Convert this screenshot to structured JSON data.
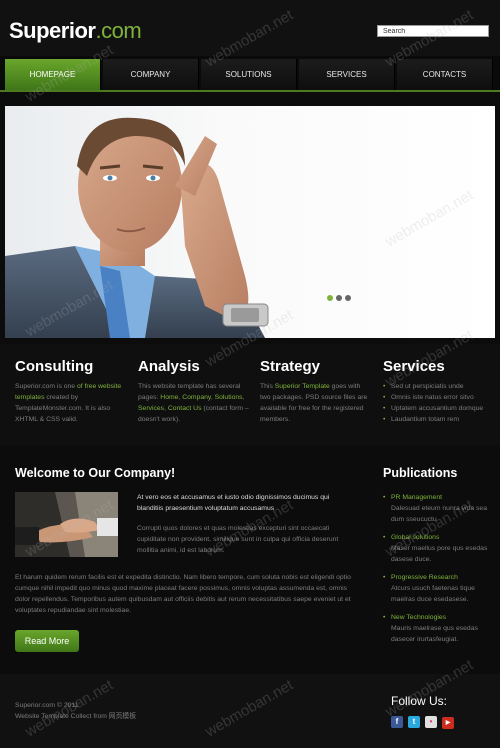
{
  "header": {
    "logo_part1": "Superior",
    "logo_part2": ".com",
    "search_value": "Search"
  },
  "nav": {
    "items": [
      {
        "label": "HOMEPAGE",
        "active": true
      },
      {
        "label": "COMPANY",
        "active": false
      },
      {
        "label": "SOLUTIONS",
        "active": false
      },
      {
        "label": "SERVICES",
        "active": false
      },
      {
        "label": "CONTACTS",
        "active": false
      }
    ]
  },
  "hero": {
    "slides": 3,
    "active_slide": 1
  },
  "columns": {
    "consulting": {
      "title": "Consulting",
      "t1": "Superior.com is one ",
      "link1": "of free website templates",
      "t2": " created by TemplateMonster.com. It is also XHTML & CSS valid."
    },
    "analysis": {
      "title": "Analysis",
      "t1": "This website template has several pages: ",
      "link1": "Home",
      "sep1": ", ",
      "link2": "Company",
      "sep2": ", ",
      "link3": "Solutions",
      "sep3": ", ",
      "link4": "Services",
      "sep4": ", ",
      "link5": "Contact Us",
      "t2": " (contact form – doesn't work)."
    },
    "strategy": {
      "title": "Strategy",
      "t1": "This ",
      "link1": "Superior Template",
      "t2": " goes with two packages. PSD source files are available for free for the registered members."
    },
    "services": {
      "title": "Services",
      "items": [
        "Sed ut perspiciatis unde",
        "Omnis iste natus error sitvo",
        "Uptatem accusantium domque",
        "Laudantium totam rem"
      ]
    }
  },
  "welcome": {
    "title": "Welcome to Our Company!",
    "lead": "At vero eos et accusamus et iusto odio dignissimos ducimus qui blanditiis praesentium voluptatum accusamus",
    "lead2": "Corrupti quos dolores et quas molestias excepturi sint occaecati cupiditate non provident, similique sunt in culpa qui officia deserunt mollitia animi, id est laborum.",
    "para": "Et harum quidem rerum facilis est et expedita distinctio. Nam libero tempore, cum soluta nobis est eligendi optio cumque nihil impedit quo minus quod maxime placeat facere possimus, omnis voluptas assumenda est, omnis dolor repellendus. Temporibus autem quibusdam aut officiis debitis aut rerum necessitatibus saepe eveniet ut et voluptates repudiandae sint molestiae.",
    "read_more": "Read More"
  },
  "publications": {
    "title": "Publications",
    "items": [
      {
        "title": "PR Management",
        "desc": "Dalesuad eteum nunra vida sea dum sseucuctu"
      },
      {
        "title": "Global solutions",
        "desc": "Maser maellus pore qus esedas dasese duce."
      },
      {
        "title": "Progressive Research",
        "desc": "Atcurs usuch faetenas tique maelras duce esedasese."
      },
      {
        "title": "New Technologies",
        "desc": "Mauris maelrase qus esedas dasecer irurtasfeugiat."
      }
    ]
  },
  "footer": {
    "copyright": "Superior.com © 2011",
    "credit": "Website Template Collect from 网页模板",
    "follow_label": "Follow Us:",
    "social": [
      {
        "name": "facebook-icon",
        "glyph": "f",
        "color": "#3b5998"
      },
      {
        "name": "twitter-icon",
        "glyph": "t",
        "color": "#2aa9e0"
      },
      {
        "name": "flickr-icon",
        "glyph": "•",
        "color": "#e0e0e0"
      },
      {
        "name": "youtube-icon",
        "glyph": "▶",
        "color": "#cc2b1d"
      }
    ]
  },
  "watermark": "webmoban.net",
  "colors": {
    "accent": "#7fb33a",
    "nav_active": "#5a9625",
    "background": "#0c0c0c"
  }
}
